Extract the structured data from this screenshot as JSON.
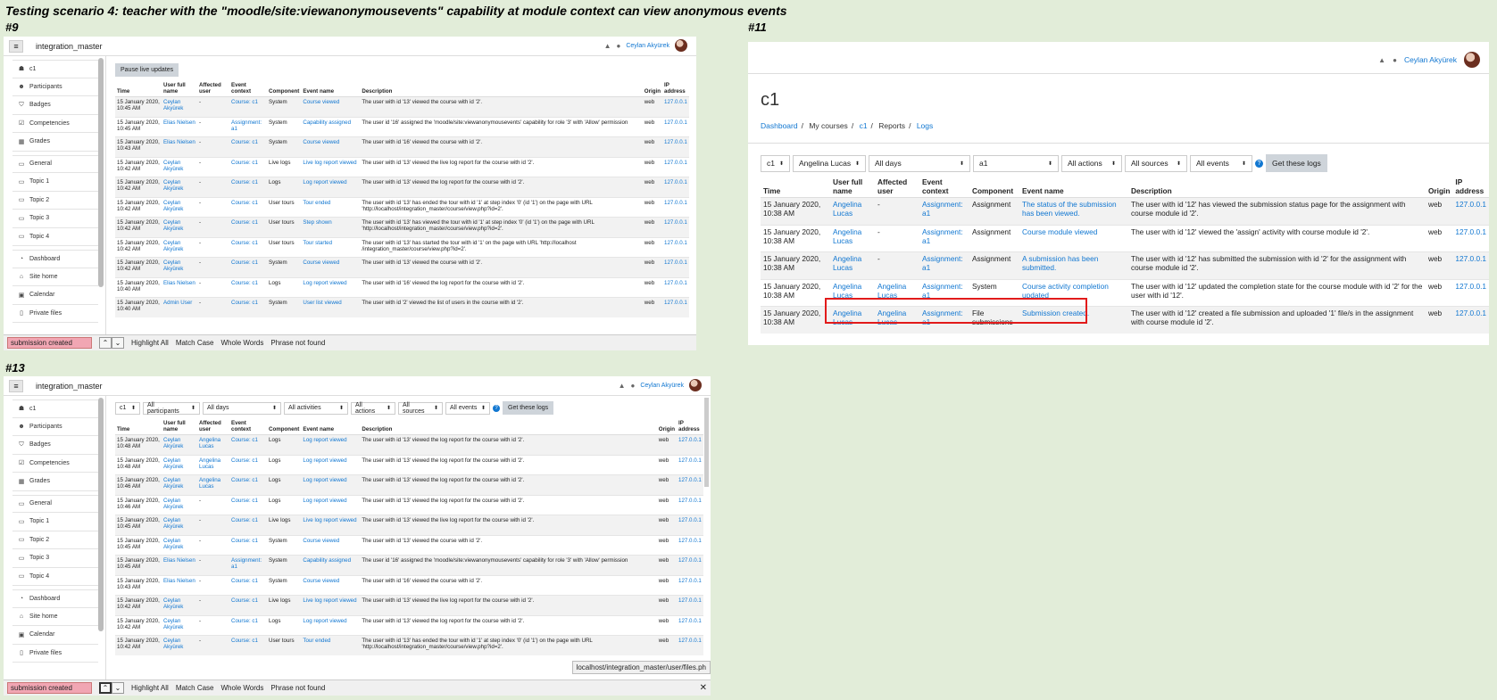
{
  "heading": "Testing scenario 4: teacher with the \"moodle/site:viewanonymousevents\" capability at module context can view anonymous events",
  "shots": {
    "s9": {
      "label": "#9",
      "site_name": "integration_master",
      "user_name": "Ceylan Akyürek",
      "pause_button": "Pause live updates",
      "find": {
        "query": "submission created",
        "highlight_all": "Highlight All",
        "match_case": "Match Case",
        "whole_words": "Whole Words",
        "status": "Phrase not found"
      },
      "rows": [
        {
          "time": "15 January 2020, 10:45 AM",
          "user": "Ceylan Akyürek",
          "affected": "-",
          "context": "Course: c1",
          "component": "System",
          "event": "Course viewed",
          "description": "The user with id '13' viewed the course with id '2'.",
          "origin": "web",
          "ip": "127.0.0.1"
        },
        {
          "time": "15 January 2020, 10:45 AM",
          "user": "Elias Nielsen",
          "affected": "-",
          "context": "Assignment: a1",
          "component": "System",
          "event": "Capability assigned",
          "description": "The user id '16' assigned the 'moodle/site:viewanonymousevents' capability for role '3' with 'Allow' permission",
          "origin": "web",
          "ip": "127.0.0.1"
        },
        {
          "time": "15 January 2020, 10:43 AM",
          "user": "Elias Nielsen",
          "affected": "-",
          "context": "Course: c1",
          "component": "System",
          "event": "Course viewed",
          "description": "The user with id '16' viewed the course with id '2'.",
          "origin": "web",
          "ip": "127.0.0.1"
        },
        {
          "time": "15 January 2020, 10:42 AM",
          "user": "Ceylan Akyürek",
          "affected": "-",
          "context": "Course: c1",
          "component": "Live logs",
          "event": "Live log report viewed",
          "description": "The user with id '13' viewed the live log report for the course with id '2'.",
          "origin": "web",
          "ip": "127.0.0.1"
        },
        {
          "time": "15 January 2020, 10:42 AM",
          "user": "Ceylan Akyürek",
          "affected": "-",
          "context": "Course: c1",
          "component": "Logs",
          "event": "Log report viewed",
          "description": "The user with id '13' viewed the log report for the course with id '2'.",
          "origin": "web",
          "ip": "127.0.0.1"
        },
        {
          "time": "15 January 2020, 10:42 AM",
          "user": "Ceylan Akyürek",
          "affected": "-",
          "context": "Course: c1",
          "component": "User tours",
          "event": "Tour ended",
          "description": "The user with id '13' has ended the tour with id '1' at step index '0' (id '1') on the page with URL 'http://localhost/integration_master/course/view.php?id=2'.",
          "origin": "web",
          "ip": "127.0.0.1"
        },
        {
          "time": "15 January 2020, 10:42 AM",
          "user": "Ceylan Akyürek",
          "affected": "-",
          "context": "Course: c1",
          "component": "User tours",
          "event": "Step shown",
          "description": "The user with id '13' has viewed the tour with id '1' at step index '0' (id '1') on the page with URL 'http://localhost/integration_master/course/view.php?id=2'.",
          "origin": "web",
          "ip": "127.0.0.1"
        },
        {
          "time": "15 January 2020, 10:42 AM",
          "user": "Ceylan Akyürek",
          "affected": "-",
          "context": "Course: c1",
          "component": "User tours",
          "event": "Tour started",
          "description": "The user with id '13' has started the tour with id '1' on the page with URL 'http://localhost /integration_master/course/view.php?id=2'.",
          "origin": "web",
          "ip": "127.0.0.1"
        },
        {
          "time": "15 January 2020, 10:42 AM",
          "user": "Ceylan Akyürek",
          "affected": "-",
          "context": "Course: c1",
          "component": "System",
          "event": "Course viewed",
          "description": "The user with id '13' viewed the course with id '2'.",
          "origin": "web",
          "ip": "127.0.0.1"
        },
        {
          "time": "15 January 2020, 10:40 AM",
          "user": "Elias Nielsen",
          "affected": "-",
          "context": "Course: c1",
          "component": "Logs",
          "event": "Log report viewed",
          "description": "The user with id '16' viewed the log report for the course with id '2'.",
          "origin": "web",
          "ip": "127.0.0.1"
        },
        {
          "time": "15 January 2020, 10:40 AM",
          "user": "Admin User",
          "affected": "-",
          "context": "Course: c1",
          "component": "System",
          "event": "User list viewed",
          "description": "The user with id '2' viewed the list of users in the course with id '2'.",
          "origin": "web",
          "ip": "127.0.0.1"
        }
      ]
    },
    "s11": {
      "label": "#11",
      "user_name": "Ceylan Akyürek",
      "page_title": "c1",
      "breadcrumb": [
        "Dashboard",
        "My courses",
        "c1",
        "Reports",
        "Logs"
      ],
      "filters": {
        "course": "c1",
        "participant": "Angelina Lucas",
        "days": "All days",
        "activity": "a1",
        "actions": "All actions",
        "sources": "All sources",
        "events": "All events",
        "get_button": "Get these logs"
      },
      "rows": [
        {
          "time": "15 January 2020, 10:38 AM",
          "user": "Angelina Lucas",
          "affected": "-",
          "context": "Assignment: a1",
          "component": "Assignment",
          "event": "The status of the submission has been viewed.",
          "description": "The user with id '12' has viewed the submission status page for the assignment with course module id '2'.",
          "origin": "web",
          "ip": "127.0.0.1"
        },
        {
          "time": "15 January 2020, 10:38 AM",
          "user": "Angelina Lucas",
          "affected": "-",
          "context": "Assignment: a1",
          "component": "Assignment",
          "event": "Course module viewed",
          "description": "The user with id '12' viewed the 'assign' activity with course module id '2'.",
          "origin": "web",
          "ip": "127.0.0.1"
        },
        {
          "time": "15 January 2020, 10:38 AM",
          "user": "Angelina Lucas",
          "affected": "-",
          "context": "Assignment: a1",
          "component": "Assignment",
          "event": "A submission has been submitted.",
          "description": "The user with id '12' has submitted the submission with id '2' for the assignment with course module id '2'.",
          "origin": "web",
          "ip": "127.0.0.1"
        },
        {
          "time": "15 January 2020, 10:38 AM",
          "user": "Angelina Lucas",
          "affected": "Angelina Lucas",
          "context": "Assignment: a1",
          "component": "System",
          "event": "Course activity completion updated",
          "description": "The user with id '12' updated the completion state for the course module with id '2' for the user with id '12'.",
          "origin": "web",
          "ip": "127.0.0.1"
        },
        {
          "time": "15 January 2020, 10:38 AM",
          "user": "Angelina Lucas",
          "affected": "Angelina Lucas",
          "context": "Assignment: a1",
          "component": "File submissions",
          "event": "Submission created.",
          "description": "The user with id '12' created a file submission and uploaded '1' file/s in the assignment with course module id '2'.",
          "origin": "web",
          "ip": "127.0.0.1"
        }
      ]
    },
    "s13": {
      "label": "#13",
      "site_name": "integration_master",
      "user_name": "Ceylan Akyürek",
      "filters": {
        "course": "c1",
        "participant": "All participants",
        "days": "All days",
        "activity": "All activities",
        "actions": "All actions",
        "sources": "All sources",
        "events": "All events",
        "get_button": "Get these logs"
      },
      "find": {
        "query": "submission created",
        "highlight_all": "Highlight All",
        "match_case": "Match Case",
        "whole_words": "Whole Words",
        "status": "Phrase not found"
      },
      "status_url": "localhost/integration_master/user/files.ph",
      "rows": [
        {
          "time": "15 January 2020, 10:48 AM",
          "user": "Ceylan Akyürek",
          "affected": "Angelina Lucas",
          "context": "Course: c1",
          "component": "Logs",
          "event": "Log report viewed",
          "description": "The user with id '13' viewed the log report for the course with id '2'.",
          "origin": "web",
          "ip": "127.0.0.1"
        },
        {
          "time": "15 January 2020, 10:48 AM",
          "user": "Ceylan Akyürek",
          "affected": "Angelina Lucas",
          "context": "Course: c1",
          "component": "Logs",
          "event": "Log report viewed",
          "description": "The user with id '13' viewed the log report for the course with id '2'.",
          "origin": "web",
          "ip": "127.0.0.1"
        },
        {
          "time": "15 January 2020, 10:46 AM",
          "user": "Ceylan Akyürek",
          "affected": "Angelina Lucas",
          "context": "Course: c1",
          "component": "Logs",
          "event": "Log report viewed",
          "description": "The user with id '13' viewed the log report for the course with id '2'.",
          "origin": "web",
          "ip": "127.0.0.1"
        },
        {
          "time": "15 January 2020, 10:46 AM",
          "user": "Ceylan Akyürek",
          "affected": "-",
          "context": "Course: c1",
          "component": "Logs",
          "event": "Log report viewed",
          "description": "The user with id '13' viewed the log report for the course with id '2'.",
          "origin": "web",
          "ip": "127.0.0.1"
        },
        {
          "time": "15 January 2020, 10:45 AM",
          "user": "Ceylan Akyürek",
          "affected": "-",
          "context": "Course: c1",
          "component": "Live logs",
          "event": "Live log report viewed",
          "description": "The user with id '13' viewed the live log report for the course with id '2'.",
          "origin": "web",
          "ip": "127.0.0.1"
        },
        {
          "time": "15 January 2020, 10:45 AM",
          "user": "Ceylan Akyürek",
          "affected": "-",
          "context": "Course: c1",
          "component": "System",
          "event": "Course viewed",
          "description": "The user with id '13' viewed the course with id '2'.",
          "origin": "web",
          "ip": "127.0.0.1"
        },
        {
          "time": "15 January 2020, 10:45 AM",
          "user": "Elias Nielsen",
          "affected": "-",
          "context": "Assignment: a1",
          "component": "System",
          "event": "Capability assigned",
          "description": "The user id '16' assigned the 'moodle/site:viewanonymousevents' capability for role '3' with 'Allow' permission",
          "origin": "web",
          "ip": "127.0.0.1"
        },
        {
          "time": "15 January 2020, 10:43 AM",
          "user": "Elias Nielsen",
          "affected": "-",
          "context": "Course: c1",
          "component": "System",
          "event": "Course viewed",
          "description": "The user with id '16' viewed the course with id '2'.",
          "origin": "web",
          "ip": "127.0.0.1"
        },
        {
          "time": "15 January 2020, 10:42 AM",
          "user": "Ceylan Akyürek",
          "affected": "-",
          "context": "Course: c1",
          "component": "Live logs",
          "event": "Live log report viewed",
          "description": "The user with id '13' viewed the live log report for the course with id '2'.",
          "origin": "web",
          "ip": "127.0.0.1"
        },
        {
          "time": "15 January 2020, 10:42 AM",
          "user": "Ceylan Akyürek",
          "affected": "-",
          "context": "Course: c1",
          "component": "Logs",
          "event": "Log report viewed",
          "description": "The user with id '13' viewed the log report for the course with id '2'.",
          "origin": "web",
          "ip": "127.0.0.1"
        },
        {
          "time": "15 January 2020, 10:42 AM",
          "user": "Ceylan Akyürek",
          "affected": "-",
          "context": "Course: c1",
          "component": "User tours",
          "event": "Tour ended",
          "description": "The user with id '13' has ended the tour with id '1' at step index '0' (id '1') on the page with URL 'http://localhost/integration_master/course/view.php?id=2'.",
          "origin": "web",
          "ip": "127.0.0.1"
        }
      ]
    }
  },
  "columns": {
    "time": "Time",
    "user": "User full name",
    "affected": "Affected user",
    "context": "Event context",
    "component": "Component",
    "event": "Event name",
    "description": "Description",
    "origin": "Origin",
    "ip": "IP address"
  },
  "drawer": [
    {
      "label": "c1",
      "icon": "graduation-cap-icon"
    },
    {
      "label": "Participants",
      "icon": "users-icon"
    },
    {
      "label": "Badges",
      "icon": "shield-icon"
    },
    {
      "label": "Competencies",
      "icon": "check-square-icon"
    },
    {
      "label": "Grades",
      "icon": "table-icon"
    },
    {
      "label": "General",
      "icon": "folder-icon"
    },
    {
      "label": "Topic 1",
      "icon": "folder-icon"
    },
    {
      "label": "Topic 2",
      "icon": "folder-icon"
    },
    {
      "label": "Topic 3",
      "icon": "folder-icon"
    },
    {
      "label": "Topic 4",
      "icon": "folder-icon"
    },
    {
      "label": "Dashboard",
      "icon": "tachometer-icon"
    },
    {
      "label": "Site home",
      "icon": "home-icon"
    },
    {
      "label": "Calendar",
      "icon": "calendar-icon"
    },
    {
      "label": "Private files",
      "icon": "file-icon"
    }
  ],
  "colors": {
    "link": "#1177d1",
    "background": "#e2edd9",
    "highlight_box": "#e21b1b",
    "find_input": "#f1a6b3"
  }
}
